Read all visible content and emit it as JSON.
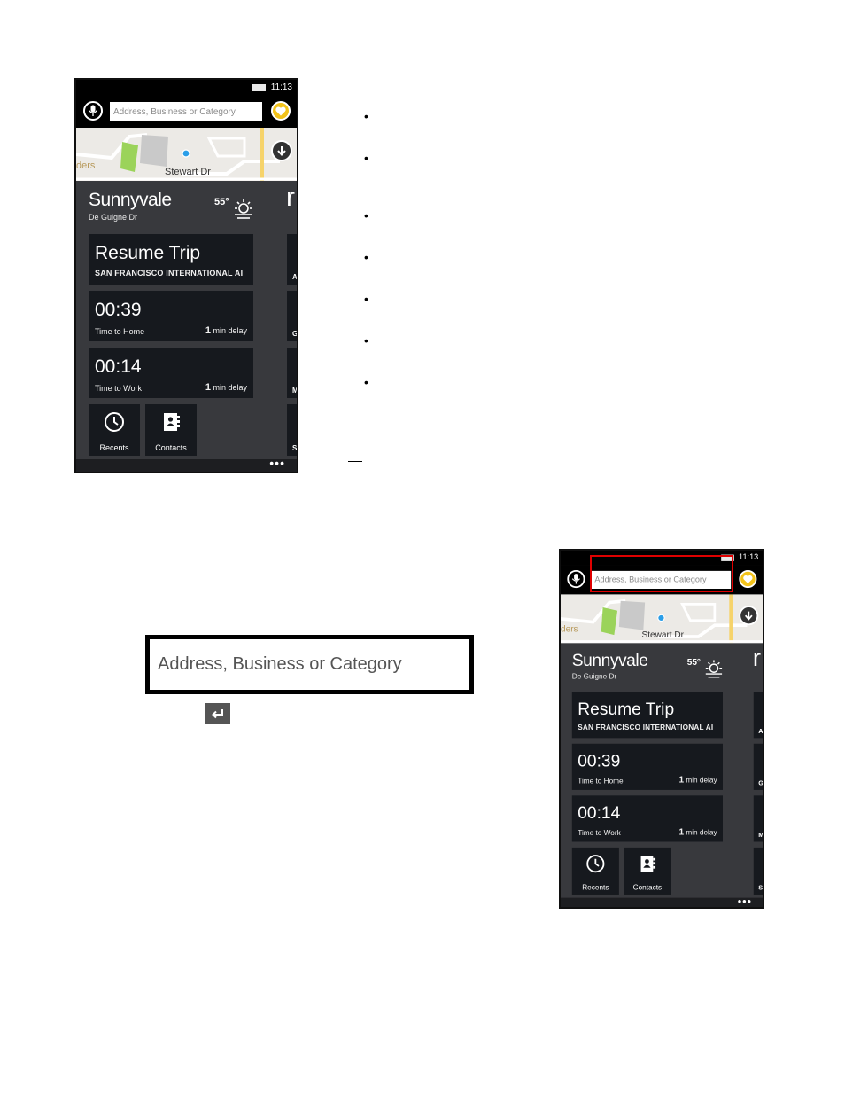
{
  "phone": {
    "status": {
      "time": "11:13"
    },
    "search": {
      "placeholder": "Address, Business or Category"
    },
    "map": {
      "street_label": "Stewart Dr",
      "edge_label": "ders"
    },
    "location": {
      "city": "Sunnyvale",
      "street": "De Guigne Dr",
      "temperature": "55°"
    },
    "next_panel_letter": "r",
    "tiles": {
      "resume": {
        "title": "Resume Trip",
        "subtitle": "SAN FRANCISCO INTERNATIONAL AI"
      },
      "home": {
        "time": "00:39",
        "label": "Time to Home",
        "delay_num": "1",
        "delay_text": " min delay"
      },
      "work": {
        "time": "00:14",
        "label": "Time to Work",
        "delay_num": "1",
        "delay_text": " min delay"
      },
      "recents": {
        "label": "Recents"
      },
      "contacts": {
        "label": "Contacts"
      }
    },
    "right_strip_letters": [
      "A",
      "G",
      "M",
      "S"
    ],
    "appbar": {
      "more": "•••"
    }
  },
  "doc": {
    "bullet_glyph": "•",
    "zoomed_field_text": "Address, Business or Category",
    "enter_key_glyph": "↵"
  },
  "colors": {
    "highlight": "#e00000",
    "favorite": "#f3c31a",
    "tile": "#16191e"
  }
}
